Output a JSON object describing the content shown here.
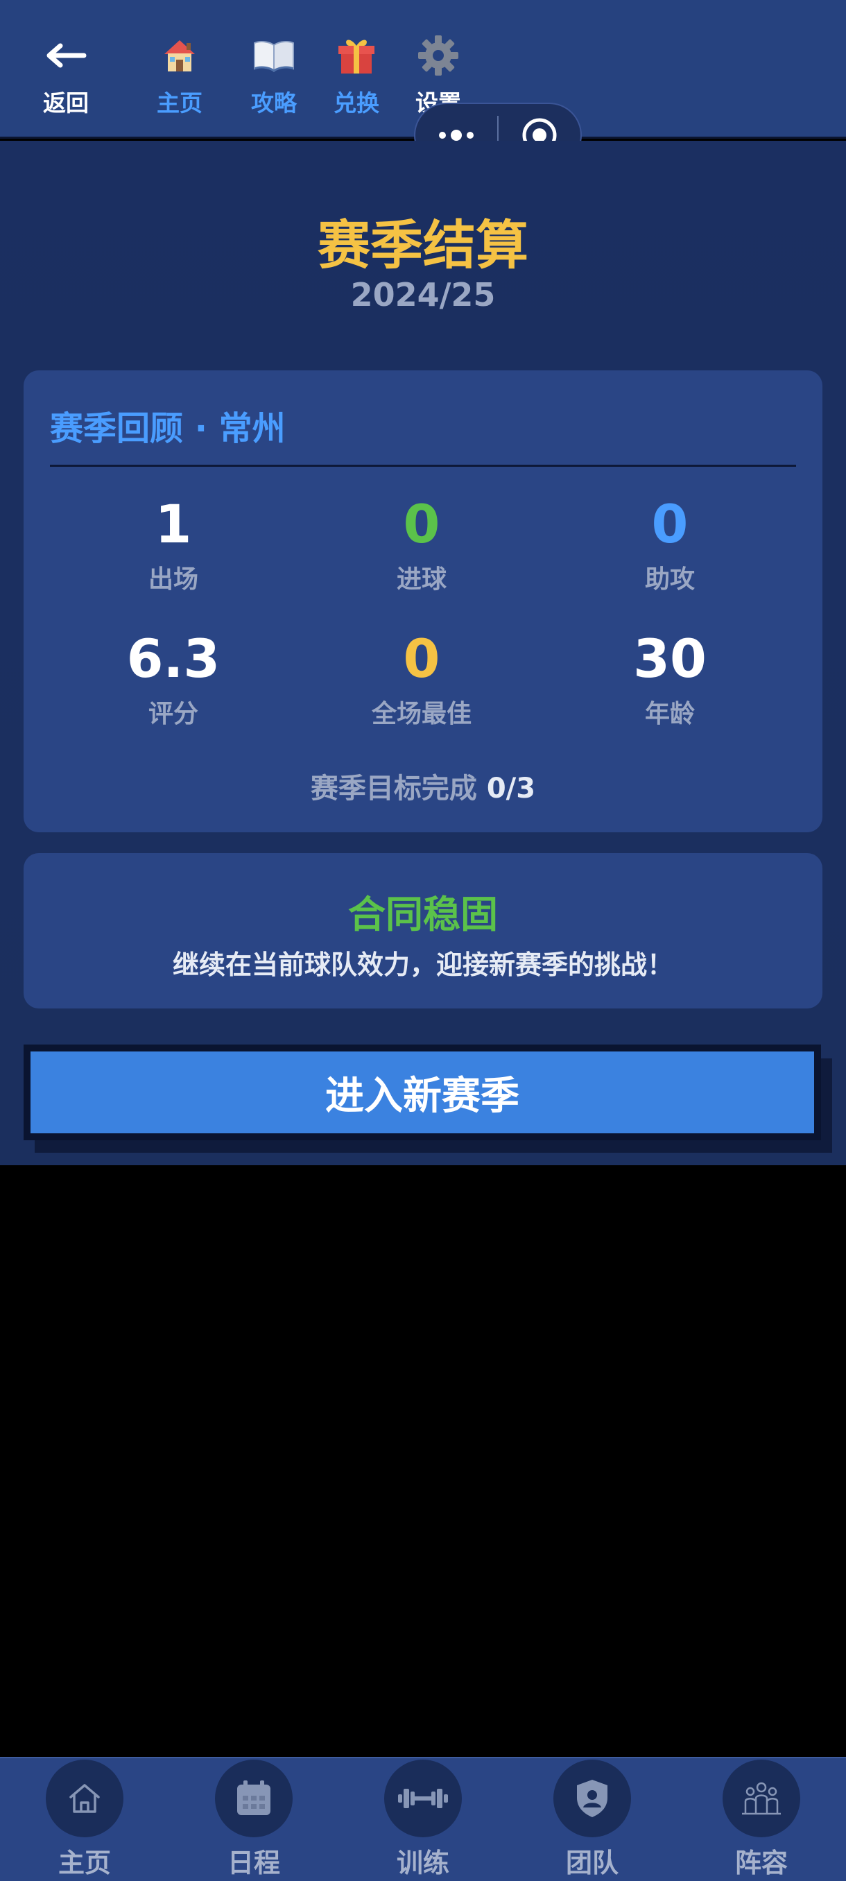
{
  "topnav": {
    "items": [
      {
        "label": "返回",
        "icon": "back-arrow-icon"
      },
      {
        "label": "主页",
        "icon": "house-icon"
      },
      {
        "label": "攻略",
        "icon": "book-icon"
      },
      {
        "label": "兑换",
        "icon": "gift-icon"
      },
      {
        "label": "设置",
        "icon": "gear-icon"
      }
    ]
  },
  "capsule": {
    "more_icon": "more-dots-icon",
    "close_icon": "target-circle-icon"
  },
  "header": {
    "title": "赛季结算",
    "season": "2024/25"
  },
  "review": {
    "heading": "赛季回顾 · 常州",
    "stats": [
      {
        "value": "1",
        "label": "出场",
        "color": "#ffffff"
      },
      {
        "value": "0",
        "label": "进球",
        "color": "#5bc24a"
      },
      {
        "value": "0",
        "label": "助攻",
        "color": "#4a9dff"
      },
      {
        "value": "6.3",
        "label": "评分",
        "color": "#ffffff"
      },
      {
        "value": "0",
        "label": "全场最佳",
        "color": "#f5c244"
      },
      {
        "value": "30",
        "label": "年龄",
        "color": "#ffffff"
      }
    ],
    "goal_label": "赛季目标完成",
    "goal_value": "0/3"
  },
  "contract": {
    "title": "合同稳固",
    "text": "继续在当前球队效力，迎接新赛季的挑战！"
  },
  "cta": {
    "label": "进入新赛季"
  },
  "tabbar": {
    "items": [
      {
        "label": "主页",
        "icon": "home-icon"
      },
      {
        "label": "日程",
        "icon": "calendar-icon"
      },
      {
        "label": "训练",
        "icon": "dumbbell-icon"
      },
      {
        "label": "团队",
        "icon": "shield-user-icon"
      },
      {
        "label": "阵容",
        "icon": "people-group-icon"
      }
    ]
  },
  "colors": {
    "accent": "#4a9dff",
    "title": "#f5c244",
    "success": "#5bc24a",
    "cta": "#3b82e0"
  }
}
